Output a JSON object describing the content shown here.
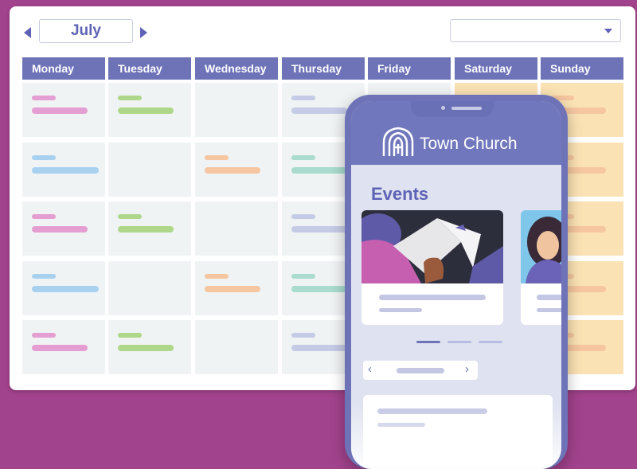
{
  "calendar": {
    "month": "July",
    "filter_selected": "",
    "weekdays": [
      "Monday",
      "Tuesday",
      "Wednesday",
      "Thursday",
      "Friday",
      "Saturday",
      "Sunday"
    ]
  },
  "colors": {
    "accent": "#6e73b8",
    "background": "#a2438d",
    "pink": "#e49ed1",
    "green": "#afd789",
    "blue": "#a8d1f0",
    "orange": "#f5c6a0",
    "teal": "#a9dcce",
    "lavender": "#c5cbe6"
  },
  "phone": {
    "app_name": "Town Church",
    "logo_icon": "church-icon",
    "section_title": "Events"
  }
}
